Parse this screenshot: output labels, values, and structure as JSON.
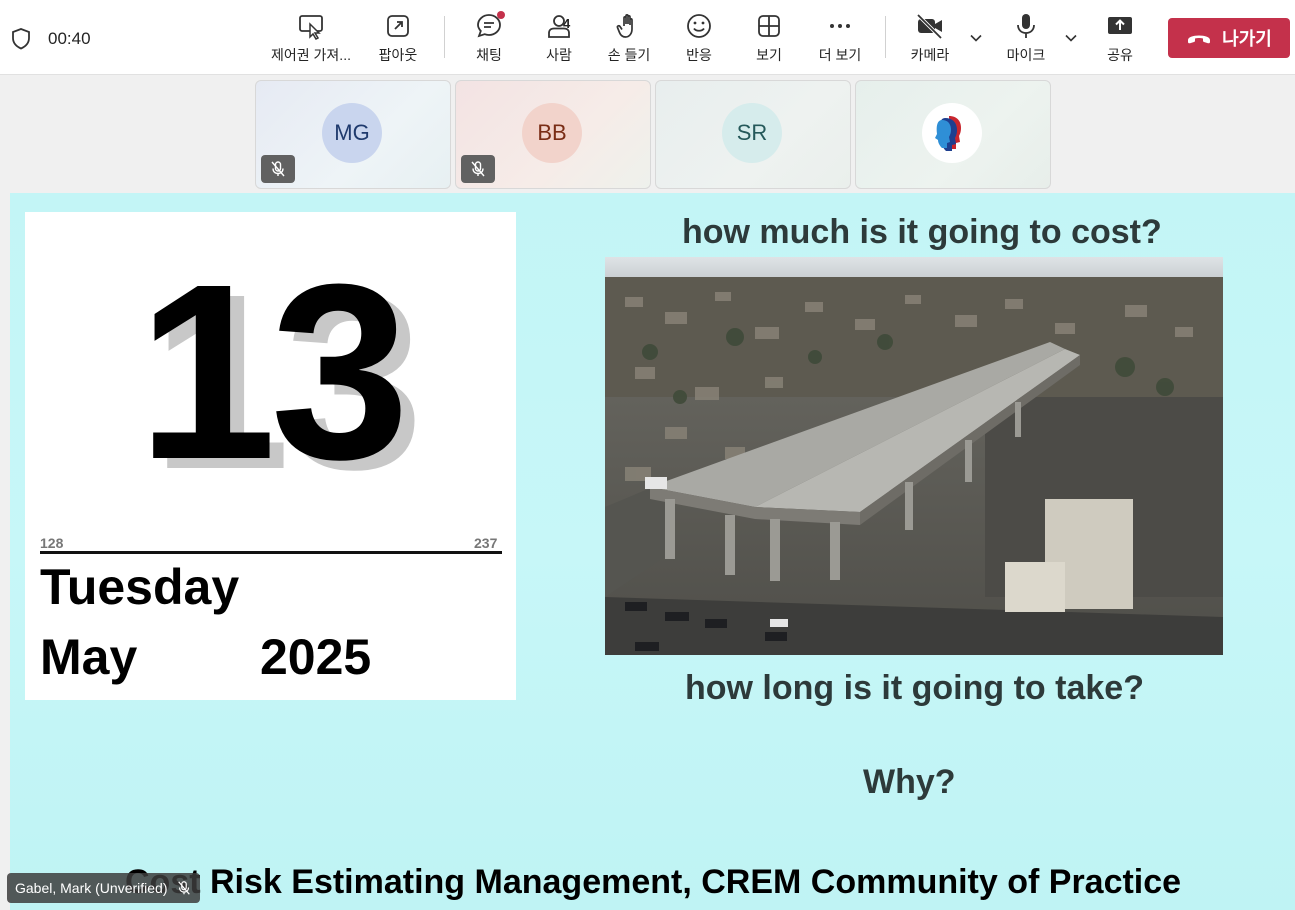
{
  "meeting": {
    "timer": "00:40"
  },
  "toolbar": {
    "control": "제어권 가져...",
    "popout": "팝아웃",
    "chat": "채팅",
    "people": "사람",
    "people_count": "4",
    "raise_hand": "손 들기",
    "react": "반응",
    "view": "보기",
    "more": "더 보기",
    "camera": "카메라",
    "mic": "마이크",
    "share": "공유",
    "leave": "나가기"
  },
  "participants": [
    {
      "initials": "MG",
      "muted": true
    },
    {
      "initials": "BB",
      "muted": true
    },
    {
      "initials": "SR",
      "muted": false
    },
    {
      "initials": "",
      "logo": "profile-heads-logo",
      "muted": false
    }
  ],
  "slide": {
    "calendar": {
      "day": "13",
      "day_of_year": "128",
      "days_remaining": "237",
      "weekday": "Tuesday",
      "month": "May",
      "year": "2025"
    },
    "question1": "how much is it going to cost?",
    "question2": "how long is it going to take?",
    "question3": "Why?",
    "title": "Cost Risk Estimating Management, CREM Community of Practice"
  },
  "presenter": {
    "name": "Gabel, Mark (Unverified)"
  },
  "colors": {
    "leave_red": "#c4314b",
    "stage_bg": "#c3f5f6"
  }
}
